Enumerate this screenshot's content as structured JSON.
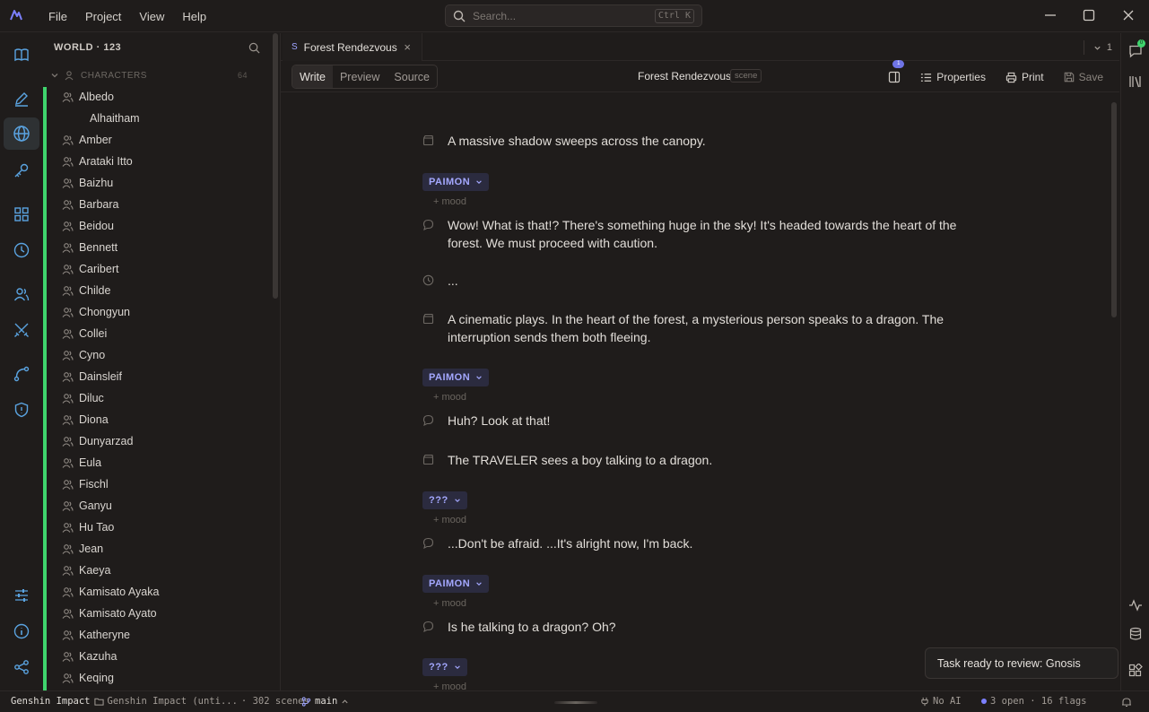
{
  "menu": [
    "File",
    "Project",
    "View",
    "Help"
  ],
  "search": {
    "placeholder": "Search...",
    "shortcut": "Ctrl K"
  },
  "activity_icons": [
    "book-icon",
    "pen-icon",
    "globe-icon",
    "key-icon",
    "grid-icon",
    "clock-icon",
    "people-icon",
    "swords-icon",
    "route-icon",
    "shield-icon",
    "sliders-icon",
    "info-icon",
    "share-icon"
  ],
  "sidebar": {
    "header": "WORLD · 123",
    "group_label": "CHARACTERS",
    "group_count": "64",
    "characters": [
      {
        "name": "Albedo",
        "nested": false
      },
      {
        "name": "Alhaitham",
        "nested": true
      },
      {
        "name": "Amber",
        "nested": false
      },
      {
        "name": "Arataki Itto",
        "nested": false
      },
      {
        "name": "Baizhu",
        "nested": false
      },
      {
        "name": "Barbara",
        "nested": false
      },
      {
        "name": "Beidou",
        "nested": false
      },
      {
        "name": "Bennett",
        "nested": false
      },
      {
        "name": "Caribert",
        "nested": false
      },
      {
        "name": "Childe",
        "nested": false
      },
      {
        "name": "Chongyun",
        "nested": false
      },
      {
        "name": "Collei",
        "nested": false
      },
      {
        "name": "Cyno",
        "nested": false
      },
      {
        "name": "Dainsleif",
        "nested": false
      },
      {
        "name": "Diluc",
        "nested": false
      },
      {
        "name": "Diona",
        "nested": false
      },
      {
        "name": "Dunyarzad",
        "nested": false
      },
      {
        "name": "Eula",
        "nested": false
      },
      {
        "name": "Fischl",
        "nested": false
      },
      {
        "name": "Ganyu",
        "nested": false
      },
      {
        "name": "Hu Tao",
        "nested": false
      },
      {
        "name": "Jean",
        "nested": false
      },
      {
        "name": "Kaeya",
        "nested": false
      },
      {
        "name": "Kamisato Ayaka",
        "nested": false
      },
      {
        "name": "Kamisato Ayato",
        "nested": false
      },
      {
        "name": "Katheryne",
        "nested": false
      },
      {
        "name": "Kazuha",
        "nested": false
      },
      {
        "name": "Keqing",
        "nested": false
      }
    ]
  },
  "tab": {
    "prefix": "S",
    "label": "Forest Rendezvous",
    "close": "×",
    "branch_count": "1"
  },
  "toolbar": {
    "modes": [
      "Write",
      "Preview",
      "Source"
    ],
    "active_mode": "Write",
    "doc_title": "Forest Rendezvous",
    "doc_type": "scene",
    "panel_badge": "1",
    "properties": "Properties",
    "print": "Print",
    "save": "Save"
  },
  "script": {
    "mood_label": "+ mood",
    "blocks": [
      {
        "kind": "action",
        "text": "A massive shadow sweeps across the canopy."
      },
      {
        "kind": "speaker",
        "text": "PAIMON"
      },
      {
        "kind": "dialogue",
        "text": "Wow! What is that!? There's something huge in the sky! It's headed towards the heart of the forest. We must proceed with caution."
      },
      {
        "kind": "pause",
        "text": "..."
      },
      {
        "kind": "action",
        "text": "A cinematic plays. In the heart of the forest, a mysterious person speaks to a dragon. The interruption sends them both fleeing."
      },
      {
        "kind": "speaker",
        "text": "PAIMON"
      },
      {
        "kind": "dialogue",
        "text": "Huh? Look at that!"
      },
      {
        "kind": "action",
        "text": "The TRAVELER sees a boy talking to a dragon."
      },
      {
        "kind": "speaker",
        "text": "???"
      },
      {
        "kind": "dialogue",
        "text": "...Don't be afraid. ...It's alright now, I'm back."
      },
      {
        "kind": "speaker",
        "text": "PAIMON"
      },
      {
        "kind": "dialogue",
        "text": "Is he talking to a dragon? Oh?"
      },
      {
        "kind": "speaker",
        "text": "???"
      }
    ]
  },
  "toast": "Task ready to review: Gnosis",
  "rightbar": {
    "chat_badge": "0"
  },
  "status": {
    "project": "Genshin Impact",
    "folder": "Genshin Impact (unti...",
    "scenes": "· 302 scenes",
    "branch": "main",
    "ai": "No AI",
    "flags": "3 open · 16 flags"
  },
  "colors": {
    "accent": "#3fd46d",
    "speaker": "#a4a8ff",
    "background": "#1f1c1b"
  }
}
